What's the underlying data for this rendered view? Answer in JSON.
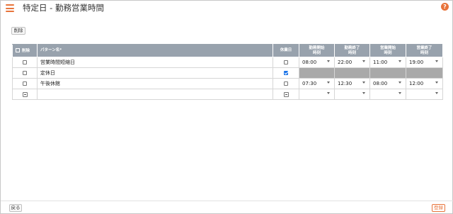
{
  "header": {
    "title": "特定日 - 勤務営業時間",
    "help": "?"
  },
  "toolbar": {
    "delete_label": "削除"
  },
  "table": {
    "columns": {
      "delete": "削除",
      "pattern": "パターン名*",
      "holiday": "休業日",
      "work_start_1": "勤務開始",
      "work_start_2": "時刻",
      "work_end_1": "勤務終了",
      "work_end_2": "時刻",
      "biz_start_1": "営業開始",
      "biz_start_2": "時刻",
      "biz_end_1": "営業終了",
      "biz_end_2": "時刻"
    },
    "rows": [
      {
        "pattern": "営業時間短縮日",
        "holiday": false,
        "work_start": "08:00",
        "work_end": "22:00",
        "biz_start": "11:00",
        "biz_end": "19:00"
      },
      {
        "pattern": "定休日",
        "holiday": true,
        "work_start": "",
        "work_end": "",
        "biz_start": "",
        "biz_end": ""
      },
      {
        "pattern": "午後休館",
        "holiday": false,
        "work_start": "07:30",
        "work_end": "12:30",
        "biz_start": "08:00",
        "biz_end": "12:00"
      },
      {
        "pattern": "",
        "holiday": false,
        "work_start": "",
        "work_end": "",
        "biz_start": "",
        "biz_end": ""
      }
    ]
  },
  "footer": {
    "back_label": "戻る",
    "register_label": "登録"
  },
  "colors": {
    "accent": "#e8743b",
    "header_bg": "#98a2ad",
    "disabled_cell": "#a9a9a9",
    "checkbox_checked": "#1a73e8"
  }
}
